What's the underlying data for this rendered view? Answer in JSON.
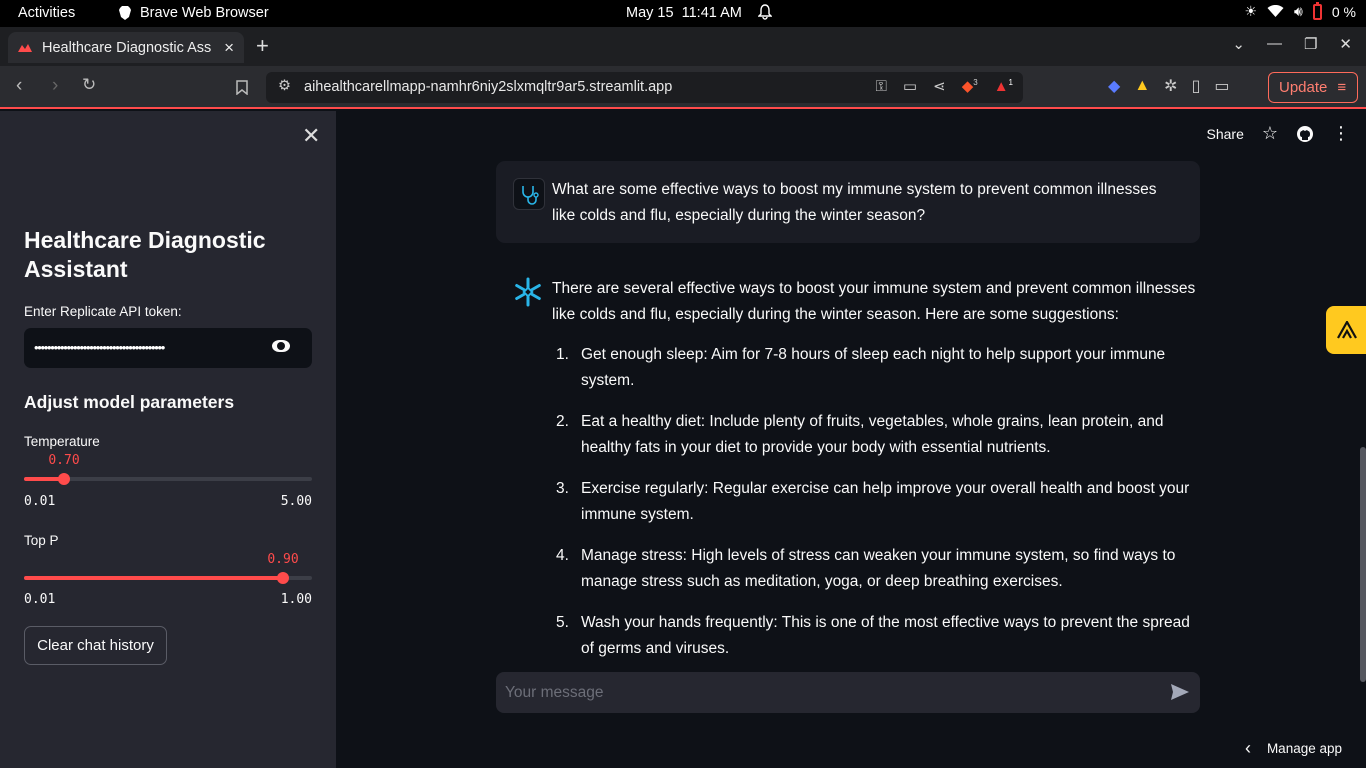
{
  "system_bar": {
    "activities": "Activities",
    "app_name": "Brave Web Browser",
    "date": "May 15",
    "time": "11:41 AM",
    "battery": "0 %"
  },
  "browser": {
    "tab_title": "Healthcare Diagnostic Assistant",
    "url": "aihealthcarellmapp-namhr6niy2slxmqltr9ar5.streamlit.app",
    "shield_count": "3",
    "rewards_count": "1",
    "update_label": "Update"
  },
  "sidebar": {
    "title": "Healthcare Diagnostic Assistant",
    "token_label": "Enter Replicate API token:",
    "token_masked": "••••••••••••••••••••••••••••••••••••••••",
    "params_heading": "Adjust model parameters",
    "temperature": {
      "label": "Temperature",
      "value": "0.70",
      "min": "0.01",
      "max": "5.00",
      "fraction": 0.138
    },
    "top_p": {
      "label": "Top P",
      "value": "0.90",
      "min": "0.01",
      "max": "1.00",
      "fraction": 0.899
    },
    "clear_label": "Clear chat history"
  },
  "header": {
    "share_label": "Share"
  },
  "chat": {
    "user_message": "What are some effective ways to boost my immune system to prevent common illnesses like colds and flu, especially during the winter season?",
    "assistant_intro": "There are several effective ways to boost your immune system and prevent common illnesses like colds and flu, especially during the winter season. Here are some suggestions:",
    "suggestions": [
      {
        "num": "1.",
        "text": "Get enough sleep: Aim for 7-8 hours of sleep each night to help support your immune system."
      },
      {
        "num": "2.",
        "text": "Eat a healthy diet: Include plenty of fruits, vegetables, whole grains, lean protein, and healthy fats in your diet to provide your body with essential nutrients."
      },
      {
        "num": "3.",
        "text": "Exercise regularly: Regular exercise can help improve your overall health and boost your immune system."
      },
      {
        "num": "4.",
        "text": "Manage stress: High levels of stress can weaken your immune system, so find ways to manage stress such as meditation, yoga, or deep breathing exercises."
      },
      {
        "num": "5.",
        "text": "Wash your hands frequently: This is one of the most effective ways to prevent the spread of germs and viruses."
      }
    ],
    "input_placeholder": "Your message"
  },
  "footer": {
    "manage_app": "Manage app"
  },
  "colors": {
    "accent": "#ff4b4b",
    "background": "#0e1117",
    "sidebar": "#262730"
  }
}
